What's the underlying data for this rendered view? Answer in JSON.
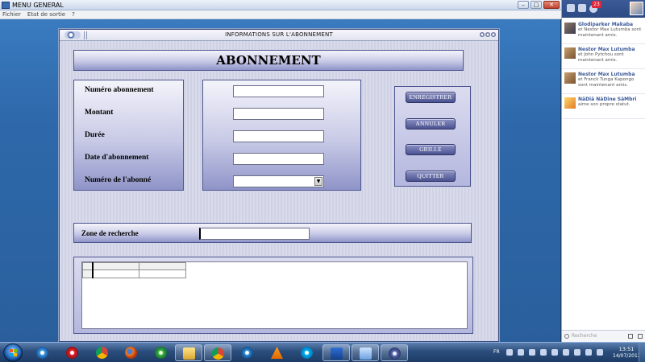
{
  "app": {
    "title": "MENU GENERAL",
    "menu": [
      "Fichier",
      "Etat de sortie",
      "?"
    ]
  },
  "child": {
    "title": "INFORMATIONS SUR L'ABONNEMENT",
    "heading": "ABONNEMENT",
    "fields": [
      {
        "label": "Numéro abonnement",
        "value": ""
      },
      {
        "label": "Montant",
        "value": ""
      },
      {
        "label": "Durée",
        "value": ""
      },
      {
        "label": "Date d'abonnement",
        "value": ""
      },
      {
        "label": "Numéro de l'abonné",
        "value": ""
      }
    ],
    "buttons": {
      "save": "ENREGISTRER",
      "cancel": "ANNULER",
      "grid": "GRILLE",
      "quit": "QUITTER"
    },
    "search": {
      "label": "Zone de recherche",
      "value": ""
    }
  },
  "side_panel": {
    "notification_count": "23",
    "feed": [
      {
        "name": "Glodiparker Makaba",
        "text": "et Nestor Max Lutumba sont maintenant amis."
      },
      {
        "name": "Nestor Max Lutumba",
        "text": "et John Pytchou sont maintenant amis."
      },
      {
        "name": "Nestor Max Lutumba",
        "text": "et Franck Tunga Kapongo sont maintenant amis."
      },
      {
        "name": "NäDiä NäDine SäMbri",
        "text": "aime son propre statut."
      }
    ],
    "search_placeholder": "Recherche"
  },
  "taskbar": {
    "language": "FR",
    "time": "13:51",
    "date": "14/07/2013"
  }
}
